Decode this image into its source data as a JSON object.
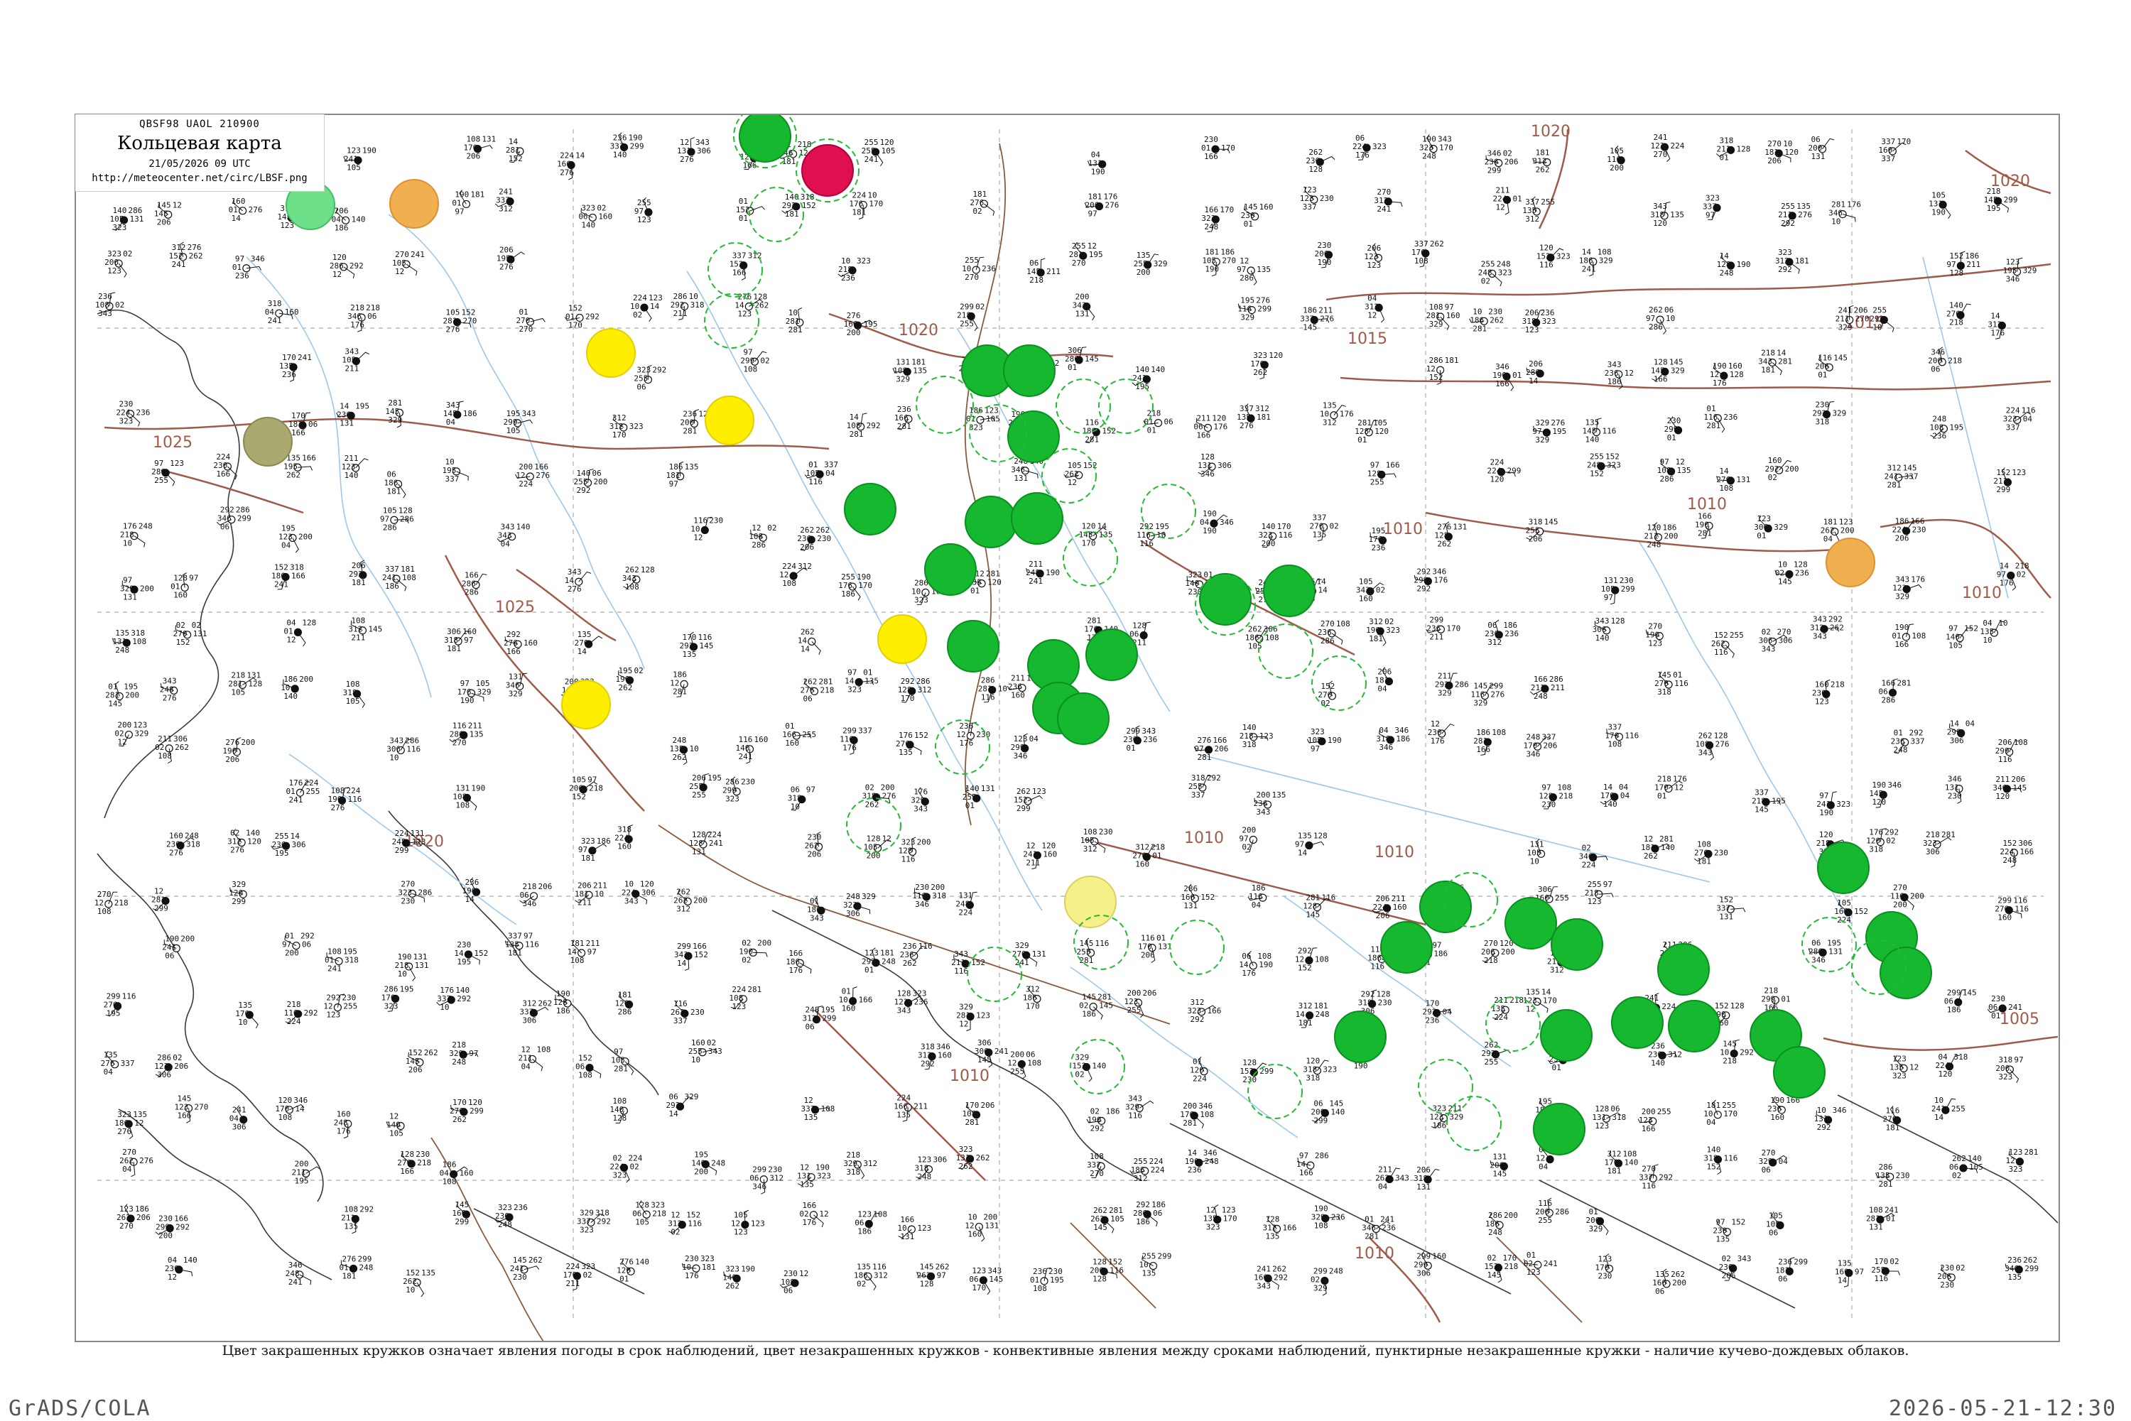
{
  "header": {
    "code": "QBSF98  UAOL  210900",
    "title": "Кольцевая карта",
    "datetime": "21/05/2026 09 UTC",
    "url": "http://meteocenter.net/circ/LBSF.png"
  },
  "caption": "Цвет закрашенных кружков означает явления погоды в срок наблюдений, цвет незакрашенных кружков - конвективные явления между сроками наблюдений, пунктирные незакрашенные кружки - наличие кучево-дождевых облаков.",
  "footer": {
    "left": "GrADS/COLA",
    "right": "2026-05-21-12:30"
  },
  "colors": {
    "isobar": "#a05a4a",
    "river": "#9cc8ea",
    "coast": "#3a3a3a",
    "rain_circle": "#00a825",
    "rain_circle_fill": "#15b82e",
    "thunder_circle": "#e01050",
    "fog_circle": "#6ee08a",
    "haze_circle": "#f0a830",
    "snow_circle": "#ffee00",
    "drizzle_circle": "#f6f08a",
    "dust_circle": "#a9a970",
    "cb_dashed_circle": "#22bb33"
  },
  "isobar_labels": [
    {
      "id": "i1",
      "text": "1020"
    },
    {
      "id": "i2",
      "text": "1020"
    },
    {
      "id": "i3",
      "text": "1020"
    },
    {
      "id": "i4",
      "text": "1015"
    },
    {
      "id": "i5",
      "text": "1015"
    },
    {
      "id": "i6",
      "text": "1010"
    },
    {
      "id": "i7",
      "text": "1010"
    },
    {
      "id": "i8",
      "text": "1010"
    },
    {
      "id": "i9",
      "text": "1010"
    },
    {
      "id": "i10",
      "text": "1010"
    },
    {
      "id": "i11",
      "text": "1010"
    },
    {
      "id": "i12",
      "text": "1010"
    },
    {
      "id": "i13",
      "text": "1005"
    },
    {
      "id": "i14",
      "text": "1025"
    },
    {
      "id": "i15",
      "text": "1025"
    },
    {
      "id": "i16",
      "text": "1020"
    }
  ],
  "map_marks": {
    "filled_rain_stations": 34,
    "dashed_cb_stations": 22,
    "note": ""
  },
  "sample_station_values": [
    "97",
    "06",
    "04",
    "02",
    "01",
    "10",
    "12",
    "14",
    "105",
    "108",
    "116",
    "120",
    "123",
    "128",
    "131",
    "135",
    "140",
    "145",
    "152",
    "160",
    "166",
    "170",
    "176",
    "181",
    "186",
    "190",
    "195",
    "200",
    "206",
    "211",
    "218",
    "224",
    "230",
    "236",
    "241",
    "248",
    "255",
    "262",
    "270",
    "276",
    "281",
    "286",
    "292",
    "299",
    "306",
    "312",
    "318",
    "323",
    "329",
    "337",
    "343",
    "346"
  ]
}
